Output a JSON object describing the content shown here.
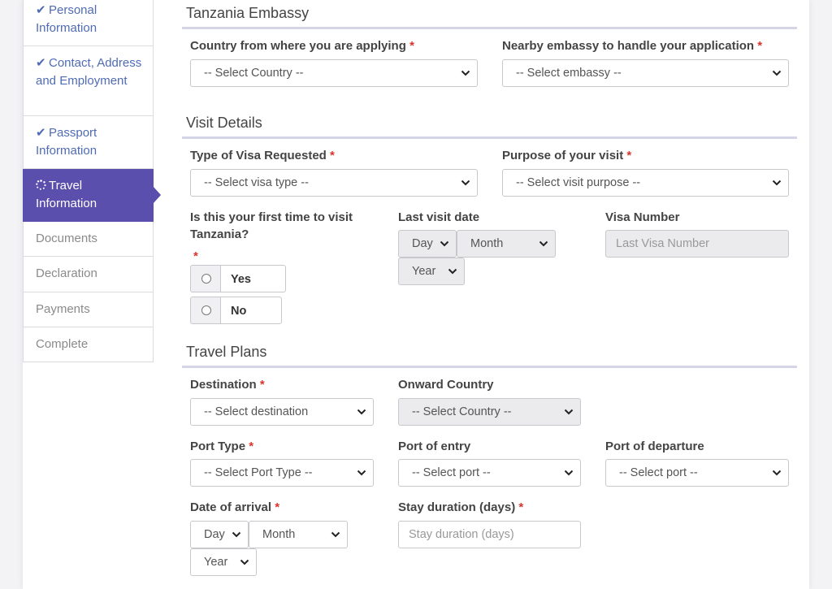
{
  "colors": {
    "accent": "#5b4fad",
    "link": "#4f6bb5",
    "required": "#d9342b"
  },
  "sidebar": {
    "items": [
      {
        "label": "Personal Information",
        "state": "done",
        "icon": "check-icon"
      },
      {
        "label": "Contact, Address and Employment",
        "state": "done",
        "icon": "check-icon"
      },
      {
        "label": "Passport Information",
        "state": "done",
        "icon": "check-icon"
      },
      {
        "label": "Travel Information",
        "state": "active",
        "icon": "spinner-icon"
      },
      {
        "label": "Documents",
        "state": "pending"
      },
      {
        "label": "Declaration",
        "state": "pending"
      },
      {
        "label": "Payments",
        "state": "pending"
      },
      {
        "label": "Complete",
        "state": "pending"
      }
    ]
  },
  "embassy": {
    "title": "Tanzania Embassy",
    "country_label": "Country from where you are applying",
    "country_value": "-- Select Country --",
    "embassy_label": "Nearby embassy to handle your application",
    "embassy_value": "-- Select embassy --"
  },
  "visit": {
    "title": "Visit Details",
    "visa_type_label": "Type of Visa Requested",
    "visa_type_value": "-- Select visa type --",
    "purpose_label": "Purpose of your visit",
    "purpose_value": "-- Select visit purpose --",
    "first_time_label": "Is this your first time to visit Tanzania?",
    "yes_label": "Yes",
    "no_label": "No",
    "last_visit_label": "Last visit date",
    "day_value": "Day",
    "month_value": "Month",
    "year_value": "Year",
    "visa_number_label": "Visa Number",
    "visa_number_placeholder": "Last Visa Number"
  },
  "plans": {
    "title": "Travel Plans",
    "destination_label": "Destination",
    "destination_value": "-- Select destination",
    "onward_label": "Onward Country",
    "onward_value": "-- Select Country --",
    "port_type_label": "Port Type",
    "port_type_value": "-- Select Port Type --",
    "port_entry_label": "Port of entry",
    "port_entry_value": "-- Select port --",
    "port_departure_label": "Port of departure",
    "port_departure_value": "-- Select port --",
    "arrival_label": "Date of arrival",
    "day_value": "Day",
    "month_value": "Month",
    "year_value": "Year",
    "stay_label": "Stay duration (days)",
    "stay_placeholder": "Stay duration (days)"
  },
  "required_mark": "*"
}
